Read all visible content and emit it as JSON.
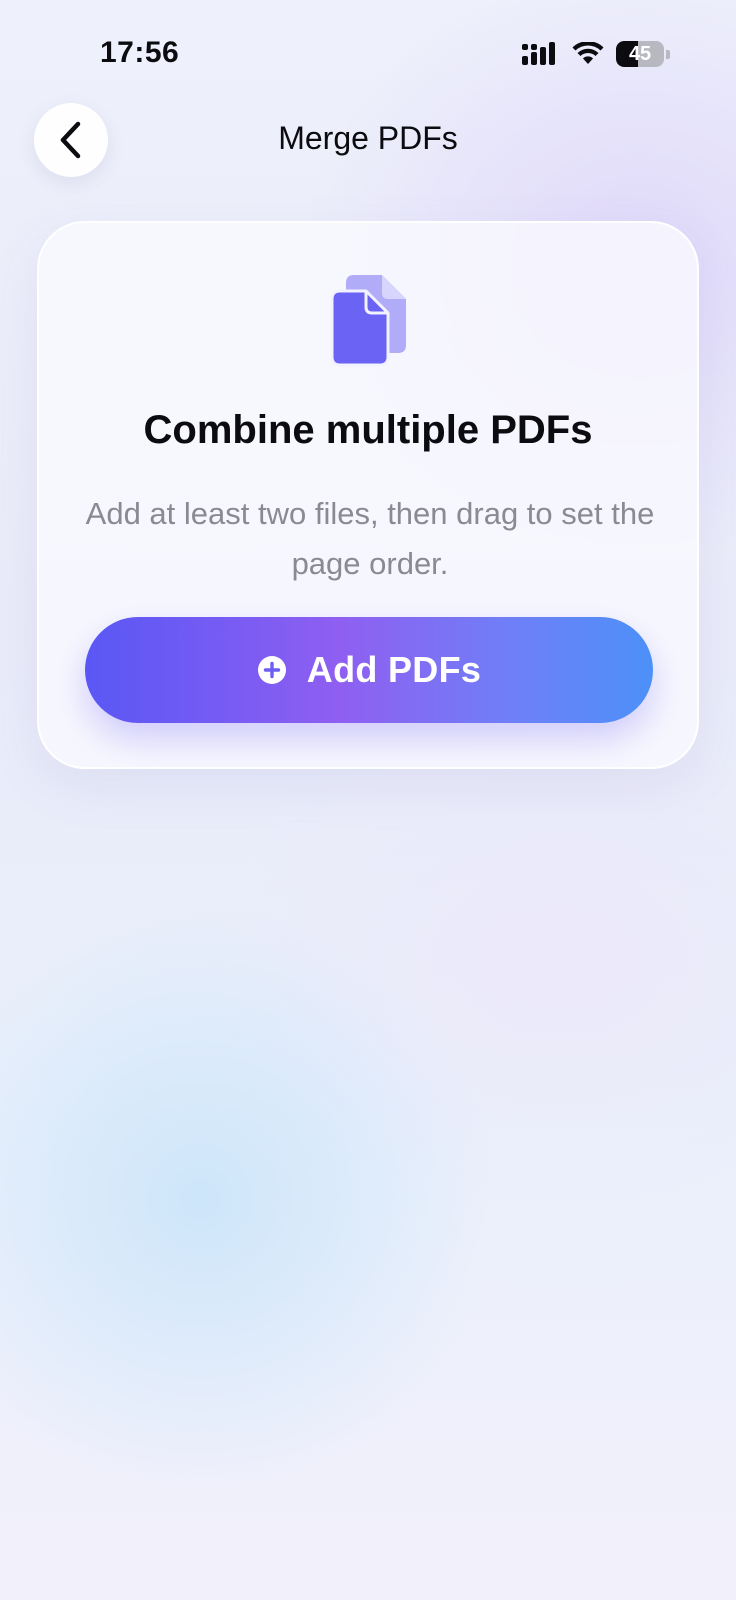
{
  "status_bar": {
    "time": "17:56",
    "battery_level": "45",
    "battery_percent": 45,
    "icons": [
      "signal-icon",
      "wifi-icon",
      "battery-icon"
    ]
  },
  "nav": {
    "back_icon": "chevron-left-icon",
    "title": "Merge PDFs"
  },
  "card": {
    "icon": "documents-icon",
    "title": "Combine multiple PDFs",
    "description": "Add at least two files, then drag to set the page order.",
    "button": {
      "icon": "plus-circle-icon",
      "label": "Add PDFs"
    }
  },
  "colors": {
    "accent_start": "#5a57f5",
    "accent_mid": "#8f5ff1",
    "accent_end": "#4c90f8",
    "icon_primary": "#6a63f4",
    "icon_secondary": "#b1acf8",
    "text_primary": "#0b0b10",
    "text_secondary": "#8a8a93"
  }
}
